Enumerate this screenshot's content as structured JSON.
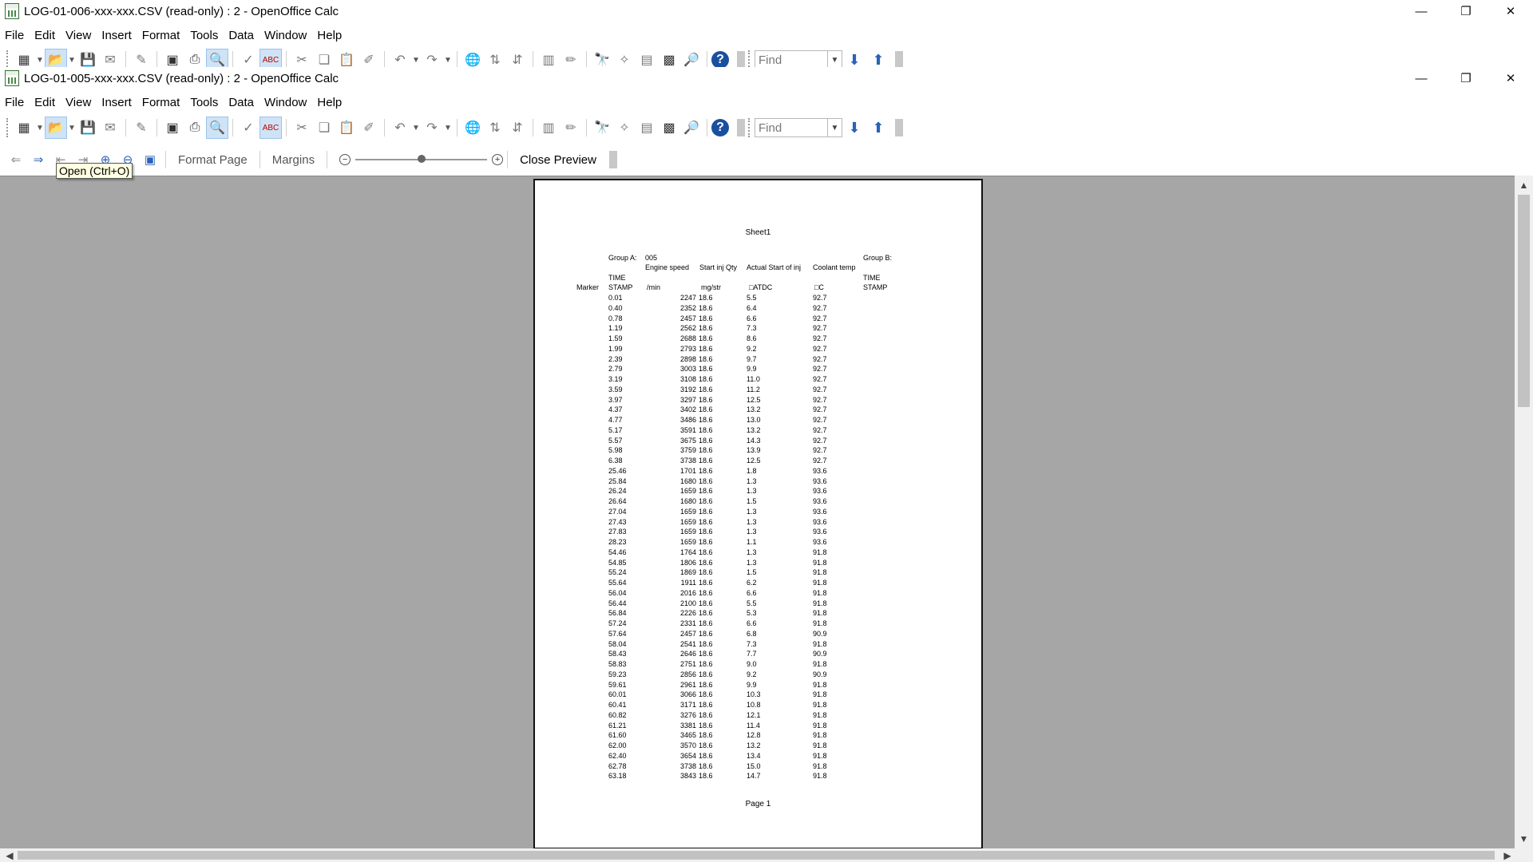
{
  "window_back": {
    "title": "LOG-01-006-xxx-xxx.CSV (read-only) : 2 - OpenOffice Calc"
  },
  "window_front": {
    "title": "LOG-01-005-xxx-xxx.CSV (read-only) : 2 - OpenOffice Calc"
  },
  "window_controls": {
    "minimize": "—",
    "restore": "❐",
    "close": "✕"
  },
  "menu": [
    "File",
    "Edit",
    "View",
    "Insert",
    "Format",
    "Tools",
    "Data",
    "Window",
    "Help"
  ],
  "toolbar": {
    "find_placeholder": "Find",
    "find_dropdown": "▼",
    "find_next": "⬇",
    "find_prev": "⬆",
    "icons": {
      "new": "▦",
      "open": "📂",
      "save": "💾",
      "email": "✉",
      "edit": "✎",
      "pdf": "▣",
      "print": "⎙",
      "preview": "🔍",
      "spell": "✓",
      "autospell": "ABC",
      "cut": "✂",
      "copy": "❏",
      "paste": "📋",
      "clone": "✐",
      "undo": "↶",
      "redo": "↷",
      "hyperlink": "🌐",
      "sort_asc": "⇅",
      "sort_desc": "⇵",
      "chart": "▥",
      "draw": "✏",
      "find_replace": "🔭",
      "navigator": "✧",
      "gallery": "▤",
      "datasources": "▩",
      "zoom": "🔎",
      "help": "?"
    }
  },
  "preview_bar": {
    "format_page": "Format Page",
    "margins": "Margins",
    "close_preview": "Close Preview",
    "zoom_minus": "−",
    "zoom_plus": "+",
    "zoom_level": 0.5
  },
  "tooltip": "Open (Ctrl+O)",
  "page": {
    "sheet_name": "Sheet1",
    "footer": "Page 1",
    "group_a_label": "Group A:",
    "group_a_value": "005",
    "group_b_label": "Group B:",
    "col_engine_speed": "Engine speed",
    "col_start_inj_qty": "Start inj Qty",
    "col_actual_start": "Actual Start of inj",
    "col_coolant": "Coolant temp",
    "time_label": "TIME",
    "stamp_label": "STAMP",
    "marker_label": "Marker",
    "unit_speed": "/min",
    "unit_qty": "mg/str",
    "unit_atdc": "□ATDC",
    "unit_coolant": "□C",
    "group_b_time": "TIME",
    "group_b_stamp": "STAMP"
  },
  "table": {
    "timestamp": [
      "0.01",
      "0.40",
      "0.78",
      "1.19",
      "1.59",
      "1.99",
      "2.39",
      "2.79",
      "3.19",
      "3.59",
      "3.97",
      "4.37",
      "4.77",
      "5.17",
      "5.57",
      "5.98",
      "6.38",
      "25.46",
      "25.84",
      "26.24",
      "26.64",
      "27.04",
      "27.43",
      "27.83",
      "28.23",
      "54.46",
      "54.85",
      "55.24",
      "55.64",
      "56.04",
      "56.44",
      "56.84",
      "57.24",
      "57.64",
      "58.04",
      "58.43",
      "58.83",
      "59.23",
      "59.61",
      "60.01",
      "60.41",
      "60.82",
      "61.21",
      "61.60",
      "62.00",
      "62.40",
      "62.78",
      "63.18"
    ],
    "engine_speed": [
      "2247",
      "2352",
      "2457",
      "2562",
      "2688",
      "2793",
      "2898",
      "3003",
      "3108",
      "3192",
      "3297",
      "3402",
      "3486",
      "3591",
      "3675",
      "3759",
      "3738",
      "1701",
      "1680",
      "1659",
      "1680",
      "1659",
      "1659",
      "1659",
      "1659",
      "1764",
      "1806",
      "1869",
      "1911",
      "2016",
      "2100",
      "2226",
      "2331",
      "2457",
      "2541",
      "2646",
      "2751",
      "2856",
      "2961",
      "3066",
      "3171",
      "3276",
      "3381",
      "3465",
      "3570",
      "3654",
      "3738",
      "3843"
    ],
    "start_inj_qty": [
      "18.6",
      "18.6",
      "18.6",
      "18.6",
      "18.6",
      "18.6",
      "18.6",
      "18.6",
      "18.6",
      "18.6",
      "18.6",
      "18.6",
      "18.6",
      "18.6",
      "18.6",
      "18.6",
      "18.6",
      "18.6",
      "18.6",
      "18.6",
      "18.6",
      "18.6",
      "18.6",
      "18.6",
      "18.6",
      "18.6",
      "18.6",
      "18.6",
      "18.6",
      "18.6",
      "18.6",
      "18.6",
      "18.6",
      "18.6",
      "18.6",
      "18.6",
      "18.6",
      "18.6",
      "18.6",
      "18.6",
      "18.6",
      "18.6",
      "18.6",
      "18.6",
      "18.6",
      "18.6",
      "18.6",
      "18.6"
    ],
    "actual_start": [
      "5.5",
      "6.4",
      "6.6",
      "7.3",
      "8.6",
      "9.2",
      "9.7",
      "9.9",
      "11.0",
      "11.2",
      "12.5",
      "13.2",
      "13.0",
      "13.2",
      "14.3",
      "13.9",
      "12.5",
      "1.8",
      "1.3",
      "1.3",
      "1.5",
      "1.3",
      "1.3",
      "1.3",
      "1.1",
      "1.3",
      "1.3",
      "1.5",
      "6.2",
      "6.6",
      "5.5",
      "5.3",
      "6.6",
      "6.8",
      "7.3",
      "7.7",
      "9.0",
      "9.2",
      "9.9",
      "10.3",
      "10.8",
      "12.1",
      "11.4",
      "12.8",
      "13.2",
      "13.4",
      "15.0",
      "14.7"
    ],
    "coolant_temp": [
      "92.7",
      "92.7",
      "92.7",
      "92.7",
      "92.7",
      "92.7",
      "92.7",
      "92.7",
      "92.7",
      "92.7",
      "92.7",
      "92.7",
      "92.7",
      "92.7",
      "92.7",
      "92.7",
      "92.7",
      "93.6",
      "93.6",
      "93.6",
      "93.6",
      "93.6",
      "93.6",
      "93.6",
      "93.6",
      "91.8",
      "91.8",
      "91.8",
      "91.8",
      "91.8",
      "91.8",
      "91.8",
      "91.8",
      "90.9",
      "91.8",
      "90.9",
      "91.8",
      "90.9",
      "91.8",
      "91.8",
      "91.8",
      "91.8",
      "91.8",
      "91.8",
      "91.8",
      "91.8",
      "91.8",
      "91.8"
    ]
  },
  "scroll": {
    "up": "▲",
    "down": "▼",
    "left": "◀",
    "right": "▶"
  }
}
